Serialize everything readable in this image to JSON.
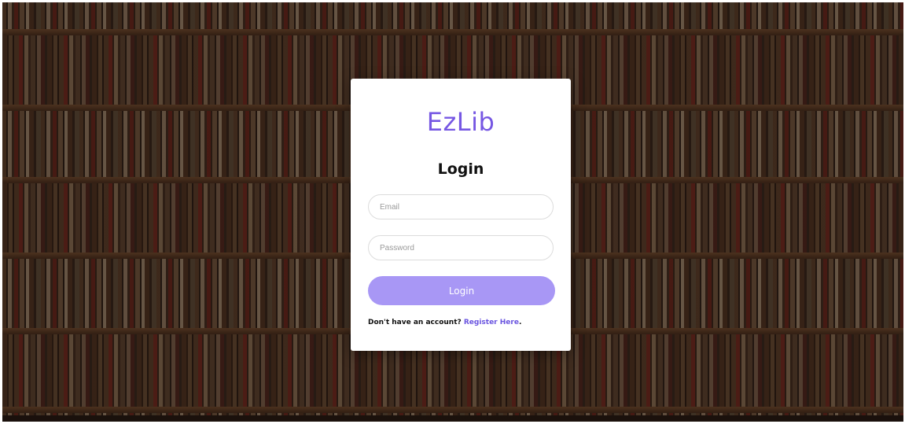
{
  "brand": {
    "name": "EzLib"
  },
  "login_form": {
    "title": "Login",
    "email_placeholder": "Email",
    "password_placeholder": "Password",
    "submit_label": "Login",
    "register_prompt": "Don't have an account? ",
    "register_link": "Register Here",
    "register_suffix": "."
  },
  "colors": {
    "brand": "#7657e3",
    "button": "#a897f5",
    "link": "#6a55e0",
    "background_theme": "bookshelf-photo"
  }
}
